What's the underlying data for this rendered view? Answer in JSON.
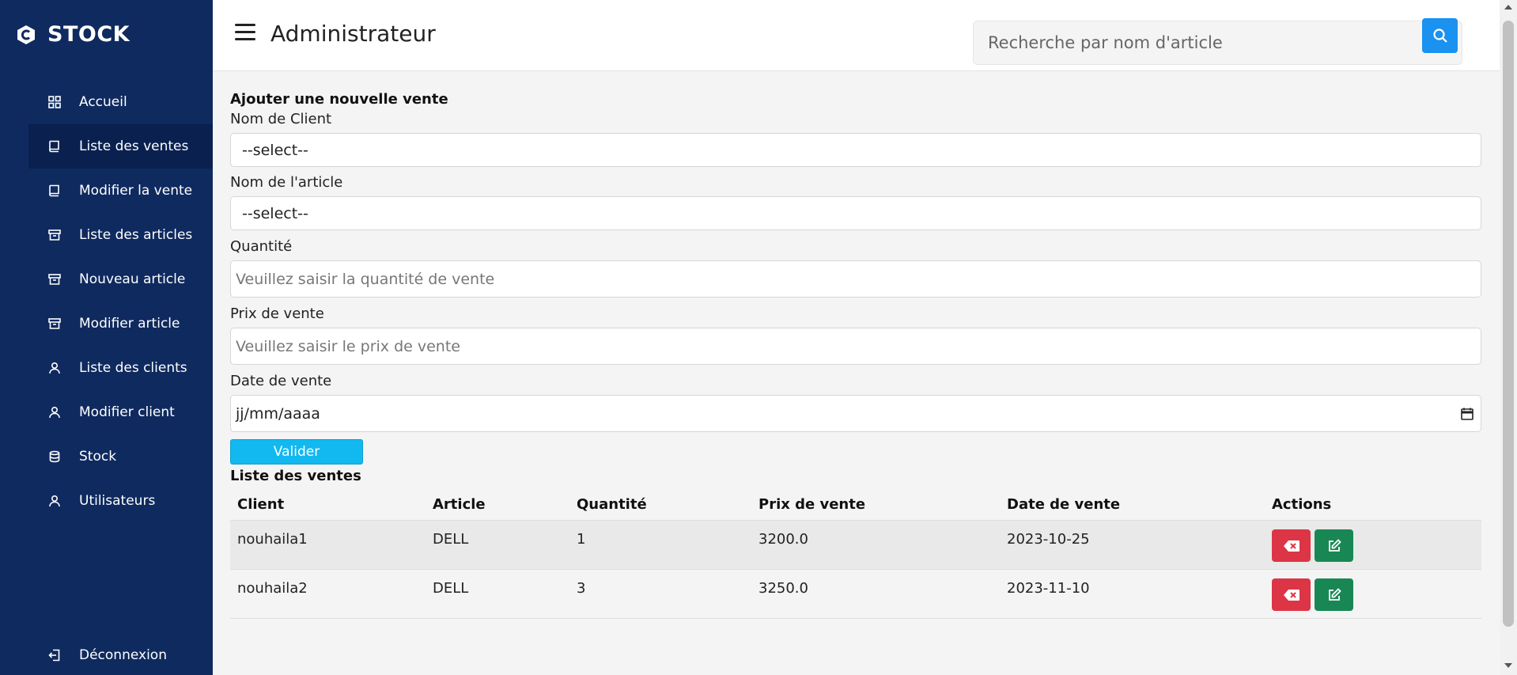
{
  "sidebar": {
    "brand": "STOCK",
    "items": [
      {
        "label": "Accueil",
        "icon": "grid-icon"
      },
      {
        "label": "Liste des ventes",
        "icon": "book-icon",
        "active": true
      },
      {
        "label": "Modifier la vente",
        "icon": "book-icon"
      },
      {
        "label": "Liste des articles",
        "icon": "archive-icon"
      },
      {
        "label": "Nouveau article",
        "icon": "archive-icon"
      },
      {
        "label": "Modifier article",
        "icon": "archive-icon"
      },
      {
        "label": "Liste des clients",
        "icon": "user-icon"
      },
      {
        "label": "Modifier client",
        "icon": "user-icon"
      },
      {
        "label": "Stock",
        "icon": "database-icon"
      },
      {
        "label": "Utilisateurs",
        "icon": "user-icon"
      }
    ],
    "logout": "Déconnexion"
  },
  "header": {
    "title": "Administrateur",
    "search_placeholder": "Recherche par nom d'article"
  },
  "form": {
    "title": "Ajouter une nouvelle vente",
    "client_label": "Nom de Client",
    "client_value": "--select--",
    "article_label": "Nom de l'article",
    "article_value": "--select--",
    "quantity_label": "Quantité",
    "quantity_placeholder": "Veuillez saisir la quantité de vente",
    "price_label": "Prix de vente",
    "price_placeholder": "Veuillez saisir le prix de vente",
    "date_label": "Date de vente",
    "date_placeholder": "jj/mm/aaaa",
    "submit": "Valider"
  },
  "table": {
    "title": "Liste des ventes",
    "headers": [
      "Client",
      "Article",
      "Quantité",
      "Prix de vente",
      "Date de vente",
      "Actions"
    ],
    "rows": [
      {
        "client": "nouhaila1",
        "article": "DELL",
        "quantity": "1",
        "price": "3200.0",
        "date": "2023-10-25"
      },
      {
        "client": "nouhaila2",
        "article": "DELL",
        "quantity": "3",
        "price": "3250.0",
        "date": "2023-11-10"
      }
    ]
  },
  "colors": {
    "sidebar_bg": "#0f2a5f",
    "accent_blue": "#1b91f0",
    "submit_cyan": "#12b9f0",
    "delete_red": "#dc3545",
    "edit_green": "#198754"
  }
}
